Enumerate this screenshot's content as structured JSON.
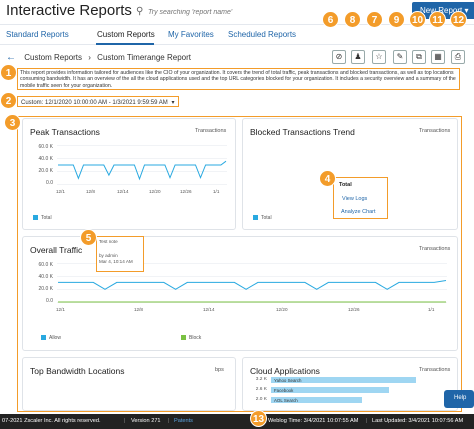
{
  "header": {
    "title": "Interactive Reports",
    "search_placeholder": "Try searching 'report name'",
    "new_report_label": "New Report"
  },
  "tabs": [
    {
      "label": "Standard Reports"
    },
    {
      "label": "Custom Reports"
    },
    {
      "label": "My Favorites"
    },
    {
      "label": "Scheduled Reports"
    }
  ],
  "breadcrumb": {
    "parent": "Custom Reports",
    "current": "Custom Timerange Report"
  },
  "toolbar_icons": [
    "hide-icon",
    "share-user-icon",
    "star-icon",
    "edit-icon",
    "copy-icon",
    "calendar-icon",
    "print-icon"
  ],
  "description": "This report provides information tailored for audiences like the CIO of your organization. It covers the trend of total traffic, peak transactions and blocked transactions, as well as top locations consuming bandwidth. It has an overview of the all the cloud applications used and the top URL categories blocked for your organization. It includes a security overview and a summary of the mobile traffic seen for your organization.",
  "time_range": "Custom: 12/1/2020 10:00:00 AM - 1/3/2021 9:59:59 AM",
  "callouts": [
    "1",
    "2",
    "3",
    "4",
    "5",
    "6",
    "8",
    "7",
    "9",
    "10",
    "11",
    "12",
    "13"
  ],
  "cards": {
    "peak": {
      "title": "Peak Transactions",
      "legend": "Transactions",
      "series_label": "Total"
    },
    "blocked": {
      "title": "Blocked Transactions Trend",
      "legend": "Transactions",
      "series_label": "Total"
    },
    "traffic": {
      "title": "Overall Traffic",
      "legend": "Transactions",
      "series_allow": "Allow",
      "series_block": "Block"
    },
    "bandwidth": {
      "title": "Top Bandwidth Locations",
      "unit": "bps"
    },
    "cloud": {
      "title": "Cloud Applications",
      "legend": "Transactions"
    }
  },
  "popup": {
    "title": "Total",
    "items": [
      "View Logs",
      "Analyze Chart"
    ]
  },
  "note": {
    "title": "Test note",
    "author": "by admin",
    "date": "Mar 4, 10:14 AM"
  },
  "chart_data": [
    {
      "type": "line",
      "title": "Peak Transactions",
      "x_ticks": [
        "12/1",
        "12/8",
        "12/14",
        "12/20",
        "12/26",
        "1/1"
      ],
      "yticks": [
        "60.0 K",
        "40.0 K",
        "20.0 K",
        "0.0"
      ],
      "ylim": [
        0,
        60000
      ],
      "series": [
        {
          "name": "Total",
          "color": "#29a9e0",
          "values": [
            30000,
            30000,
            30000,
            30000,
            9000,
            30000,
            30000,
            30000,
            30000,
            30000,
            14000,
            30000,
            30000,
            30000,
            30000,
            30000,
            8000,
            30000,
            30000,
            30000,
            30000,
            30000,
            10000,
            30000,
            30000,
            30000,
            30000,
            30000,
            10000,
            30000,
            30000,
            30000,
            30000,
            36000
          ]
        }
      ]
    },
    {
      "type": "line",
      "title": "Overall Traffic",
      "x_ticks": [
        "12/1",
        "12/8",
        "12/14",
        "12/20",
        "12/26",
        "1/1"
      ],
      "yticks": [
        "60.0 K",
        "40.0 K",
        "20.0 K",
        "0.0"
      ],
      "ylim": [
        0,
        60000
      ],
      "series": [
        {
          "name": "Allow",
          "color": "#29a9e0",
          "values": [
            31000,
            31000,
            31000,
            31000,
            20000,
            31000,
            31000,
            31000,
            31000,
            31000,
            20000,
            31000,
            31000,
            31000,
            31000,
            31000,
            20000,
            31000,
            31000,
            31000,
            31000,
            31000,
            20000,
            31000,
            31000,
            31000,
            31000,
            31000,
            20000,
            31000,
            31000,
            31000,
            31000,
            34000
          ]
        },
        {
          "name": "Block",
          "color": "#7ac143",
          "values": [
            0,
            0,
            0,
            0,
            0,
            0,
            0,
            0,
            0,
            0,
            0,
            0,
            0,
            0,
            0,
            0,
            0,
            0,
            0,
            0,
            0,
            0,
            0,
            0,
            0,
            0,
            0,
            0,
            0,
            0,
            0,
            0,
            0,
            0
          ]
        }
      ]
    },
    {
      "type": "bar",
      "title": "Cloud Applications",
      "categories": [
        "Yahoo Search",
        "Facebook",
        "AOL Search"
      ],
      "values": [
        3200,
        2600,
        2000
      ],
      "ytick_labels": [
        "3.2 K",
        "2.6 K",
        "2.0 K"
      ],
      "color": "#9fd6f2"
    }
  ],
  "footer": {
    "copyright": "07-2021 Zscaler Inc. All rights reserved.",
    "version": "Version 271",
    "patents": "Patents",
    "weblog_time": "Weblog Time: 3/4/2021 10:07:55 AM",
    "last_updated": "Last Updated: 3/4/2021 10:07:56 AM"
  },
  "help_label": "Help"
}
